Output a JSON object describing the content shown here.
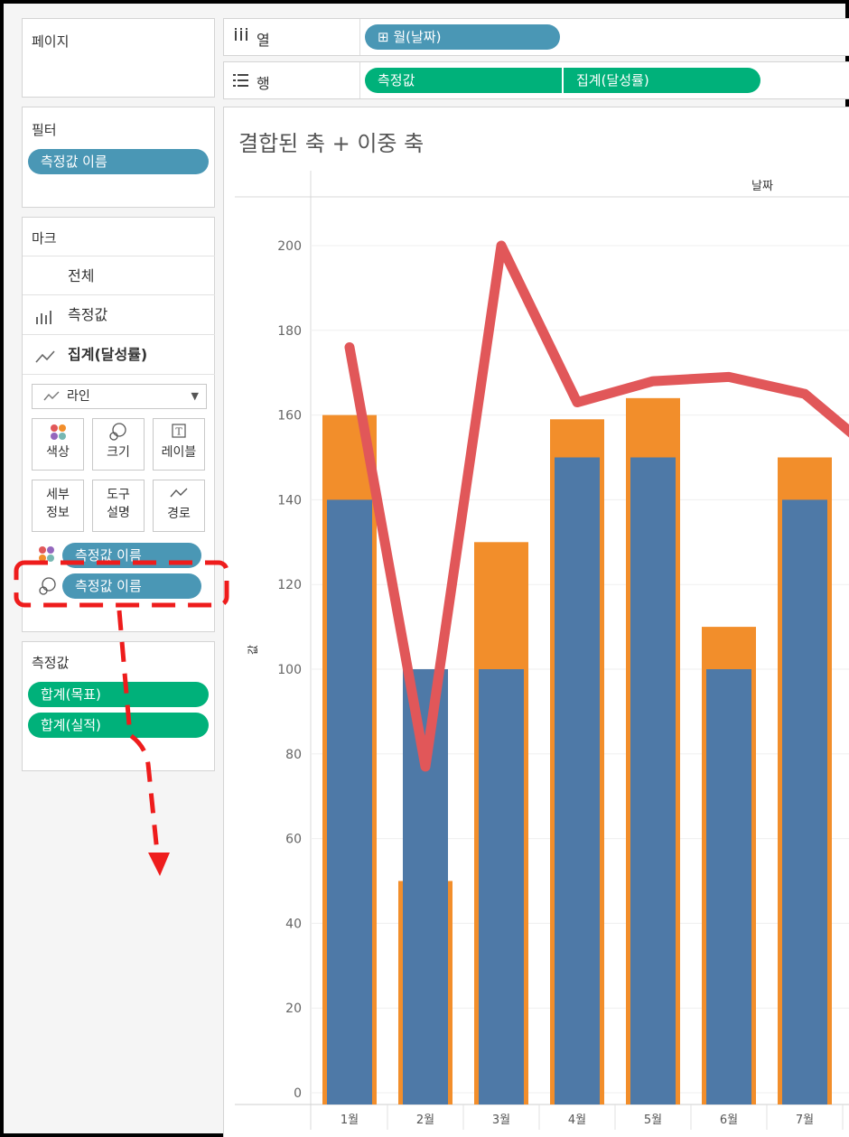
{
  "pages_panel": {
    "title": "페이지"
  },
  "filters_panel": {
    "title": "필터",
    "pill": "측정값 이름"
  },
  "marks_panel": {
    "title": "마크",
    "rows": [
      {
        "label": "전체",
        "icon": ""
      },
      {
        "label": "측정값",
        "icon": "bar-chart-icon"
      },
      {
        "label": "집계(달성률)",
        "icon": "line-chart-icon"
      }
    ],
    "mark_type": "라인",
    "buttons": [
      {
        "label": "색상",
        "icon": "color-dots-icon"
      },
      {
        "label": "크기",
        "icon": "size-icon"
      },
      {
        "label": "레이블",
        "icon": "label-T-icon"
      },
      {
        "label": "세부\n정보",
        "icon": ""
      },
      {
        "label": "도구\n설명",
        "icon": ""
      },
      {
        "label": "경로",
        "icon": "path-icon"
      }
    ],
    "encodings": [
      {
        "label": "측정값 이름",
        "icon": "color-dots-icon"
      },
      {
        "label": "측정값 이름",
        "icon": "size-icon"
      }
    ]
  },
  "measures_panel": {
    "title": "측정값",
    "pills": [
      "합계(목표)",
      "합계(실적)"
    ]
  },
  "columns_shelf": {
    "label": "열",
    "icon": "columns-icon",
    "pill": "⊞ 월(날짜)"
  },
  "rows_shelf": {
    "label": "행",
    "icon": "rows-icon",
    "pills": [
      "측정값",
      "집계(달성률)"
    ]
  },
  "chart": {
    "title": "결합된 축 + 이중 축",
    "column_header": "날짜",
    "axis_label": "값"
  },
  "colors": {
    "bar_target": "#f28e2b",
    "bar_actual": "#4e79a7",
    "line": "#e15759",
    "pill_blue": "#4a97b5",
    "pill_green": "#00b17a",
    "annotation": "#ee1c1c"
  },
  "chart_data": {
    "type": "bar",
    "categories": [
      "1월",
      "2월",
      "3월",
      "4월",
      "5월",
      "6월",
      "7월"
    ],
    "series": [
      {
        "name": "합계(목표)",
        "values": [
          160,
          50,
          130,
          159,
          164,
          110,
          150
        ]
      },
      {
        "name": "합계(실적)",
        "values": [
          140,
          100,
          100,
          150,
          150,
          100,
          140
        ]
      }
    ],
    "line_series": {
      "name": "집계(달성률)",
      "values": [
        176,
        77,
        200,
        163,
        168,
        169,
        165,
        150
      ]
    },
    "y_ticks": [
      0,
      20,
      40,
      60,
      80,
      100,
      120,
      140,
      160,
      180,
      200
    ],
    "ylim": [
      0,
      200
    ],
    "grid": true
  }
}
